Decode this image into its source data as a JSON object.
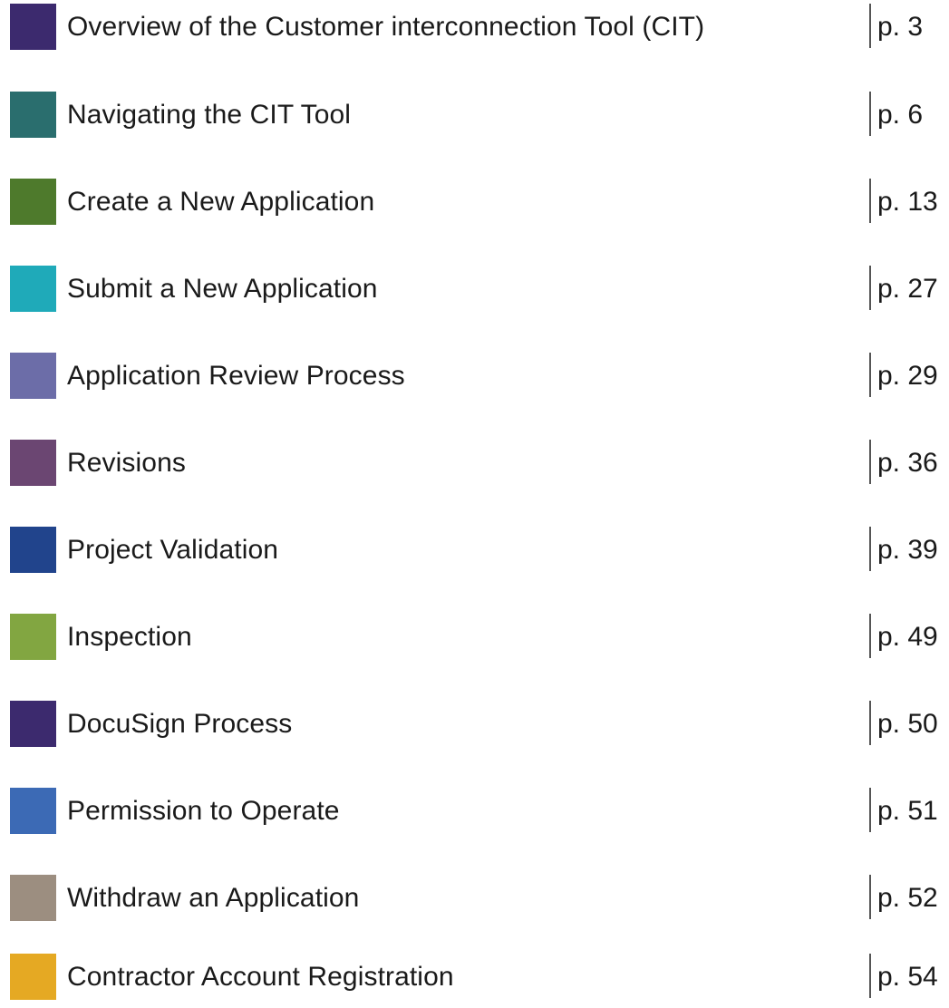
{
  "toc": {
    "entries": [
      {
        "title": "Overview of the Customer interconnection Tool (CIT)",
        "page": "p. 3",
        "color": "#3c2a6e"
      },
      {
        "title": "Navigating the CIT Tool",
        "page": "p. 6",
        "color": "#2a6e6e"
      },
      {
        "title": "Create a New Application",
        "page": "p. 13",
        "color": "#4e7a2c"
      },
      {
        "title": "Submit a New Application",
        "page": "p. 27",
        "color": "#1faab9"
      },
      {
        "title": "Application Review Process",
        "page": "p. 29",
        "color": "#6c6da8"
      },
      {
        "title": "Revisions",
        "page": "p. 36",
        "color": "#6b4672"
      },
      {
        "title": "Project Validation",
        "page": "p. 39",
        "color": "#21448c"
      },
      {
        "title": "Inspection",
        "page": "p. 49",
        "color": "#82a641"
      },
      {
        "title": "DocuSign Process",
        "page": "p. 50",
        "color": "#3c2a6e"
      },
      {
        "title": "Permission to Operate",
        "page": "p. 51",
        "color": "#3c6ab5"
      },
      {
        "title": "Withdraw an Application",
        "page": "p. 52",
        "color": "#9c8e80"
      },
      {
        "title": "Contractor Account Registration",
        "page": "p. 54",
        "color": "#e5a923"
      }
    ]
  }
}
